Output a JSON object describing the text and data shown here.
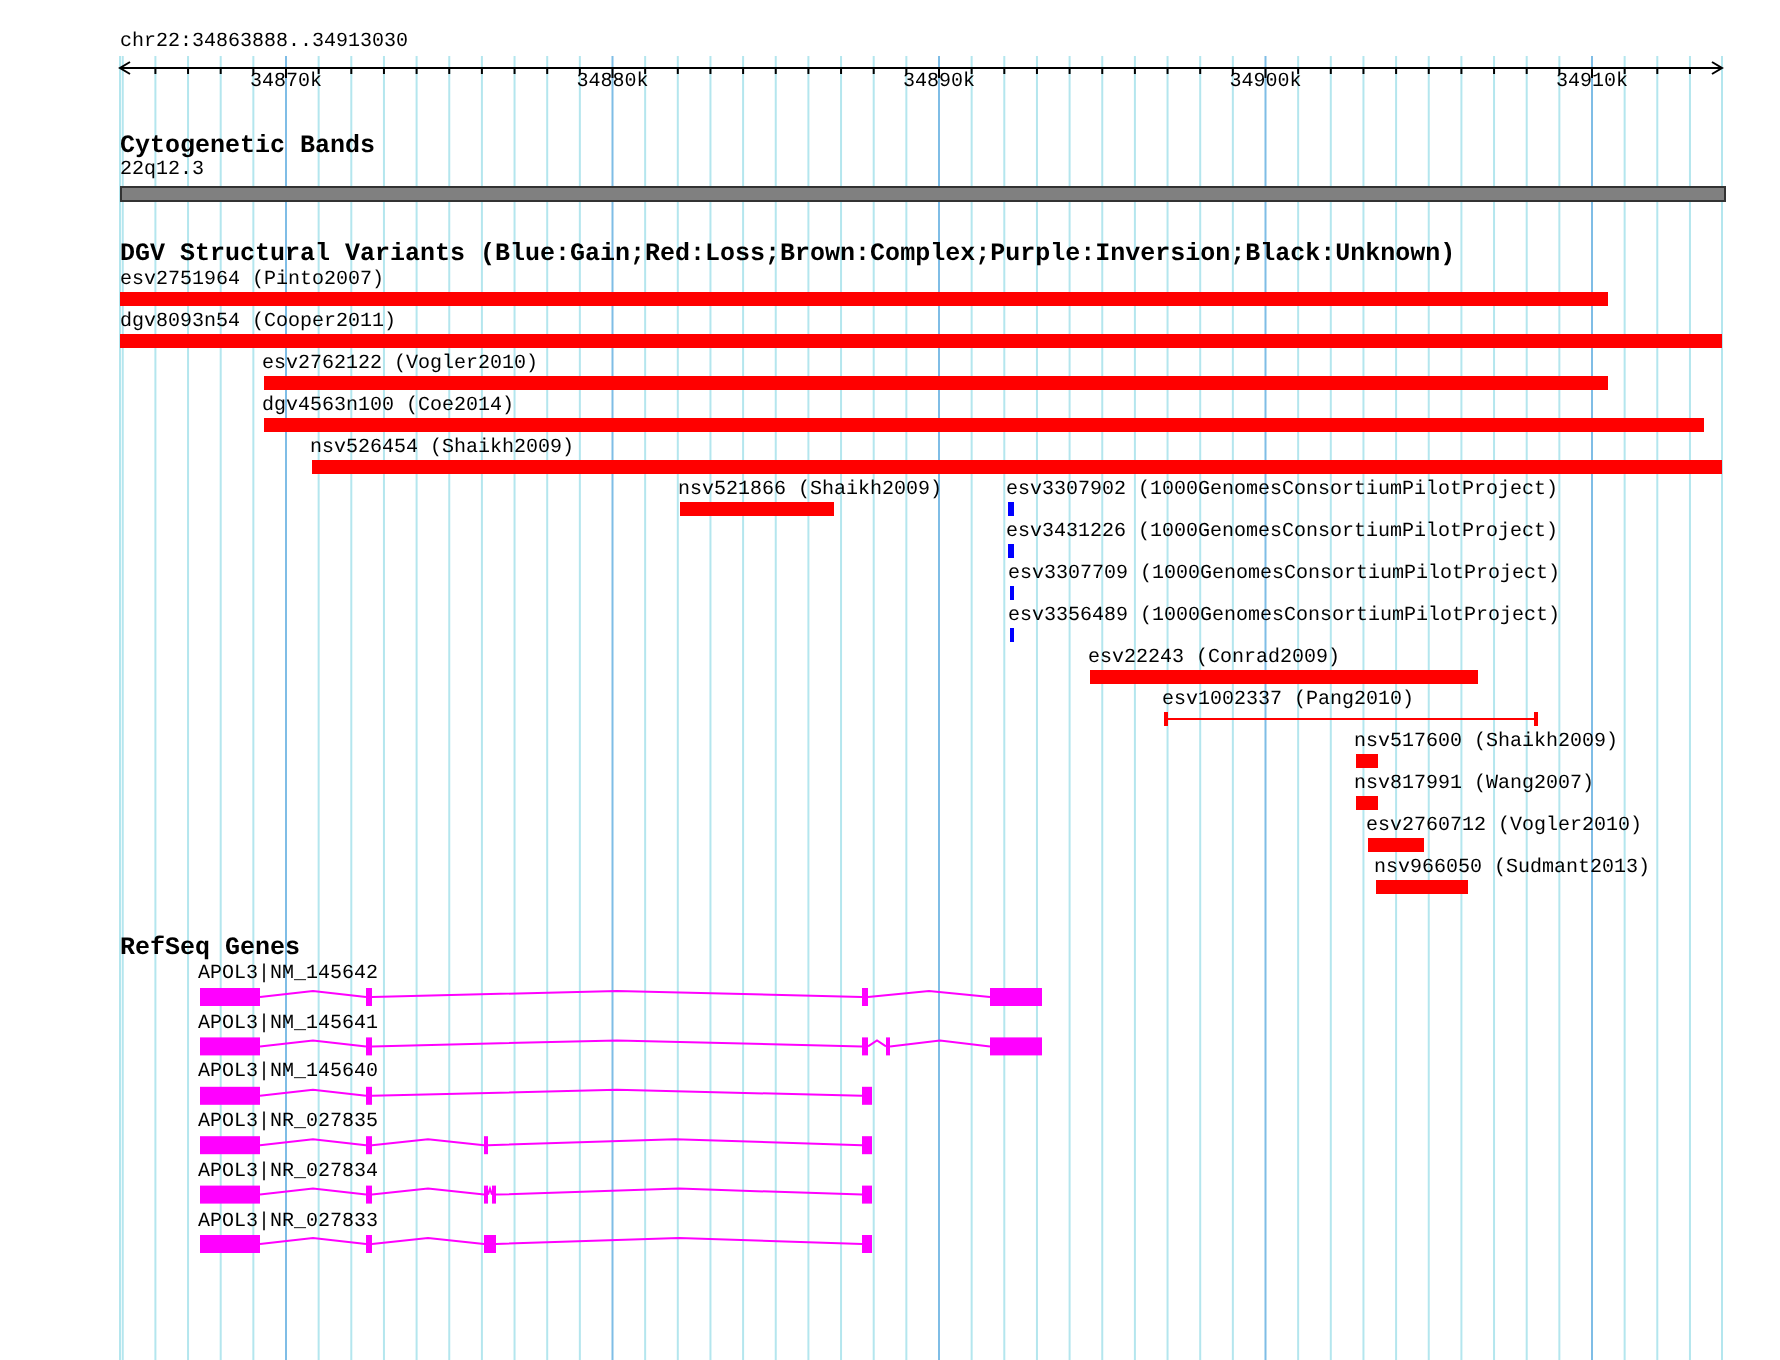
{
  "header": {
    "region": "chr22:34863888..34913030"
  },
  "ruler": {
    "ticks": [
      "34870k",
      "34880k",
      "34890k",
      "34900k",
      "34910k"
    ]
  },
  "cytogenetic_bands": {
    "title": "Cytogenetic Bands",
    "band_label": "22q12.3"
  },
  "structural_variants": {
    "title": "DGV Structural Variants (Blue:Gain;Red:Loss;Brown:Complex;Purple:Inversion;Black:Unknown)",
    "features": [
      {
        "label": "esv2751964 (Pinto2007)",
        "kind": "bar",
        "color": "#ff0000"
      },
      {
        "label": "dgv8093n54 (Cooper2011)",
        "kind": "bar",
        "color": "#ff0000"
      },
      {
        "label": "esv2762122 (Vogler2010)",
        "kind": "bar",
        "color": "#ff0000"
      },
      {
        "label": "dgv4563n100 (Coe2014)",
        "kind": "bar",
        "color": "#ff0000"
      },
      {
        "label": "nsv526454 (Shaikh2009)",
        "kind": "bar",
        "color": "#ff0000"
      },
      {
        "label": "nsv521866 (Shaikh2009)",
        "kind": "bar",
        "color": "#ff0000"
      },
      {
        "label": "esv3307902 (1000GenomesConsortiumPilotProject)",
        "kind": "bar",
        "color": "#0000ff"
      },
      {
        "label": "esv3431226 (1000GenomesConsortiumPilotProject)",
        "kind": "bar",
        "color": "#0000ff"
      },
      {
        "label": "esv3307709 (1000GenomesConsortiumPilotProject)",
        "kind": "bar",
        "color": "#0000ff"
      },
      {
        "label": "esv3356489 (1000GenomesConsortiumPilotProject)",
        "kind": "bar",
        "color": "#0000ff"
      },
      {
        "label": "esv22243 (Conrad2009)",
        "kind": "bar",
        "color": "#ff0000"
      },
      {
        "label": "esv1002337 (Pang2010)",
        "kind": "span",
        "color": "#ff0000"
      },
      {
        "label": "nsv517600 (Shaikh2009)",
        "kind": "bar",
        "color": "#ff0000"
      },
      {
        "label": "nsv817991 (Wang2007)",
        "kind": "bar",
        "color": "#ff0000"
      },
      {
        "label": "esv2760712 (Vogler2010)",
        "kind": "bar",
        "color": "#ff0000"
      },
      {
        "label": "nsv966050 (Sudmant2013)",
        "kind": "bar",
        "color": "#ff0000"
      }
    ]
  },
  "refseq_genes": {
    "title": "RefSeq Genes",
    "transcripts": [
      {
        "label": "APOL3|NM_145642"
      },
      {
        "label": "APOL3|NM_145641"
      },
      {
        "label": "APOL3|NM_145640"
      },
      {
        "label": "APOL3|NR_027835"
      },
      {
        "label": "APOL3|NR_027834"
      },
      {
        "label": "APOL3|NR_027833"
      }
    ]
  }
}
